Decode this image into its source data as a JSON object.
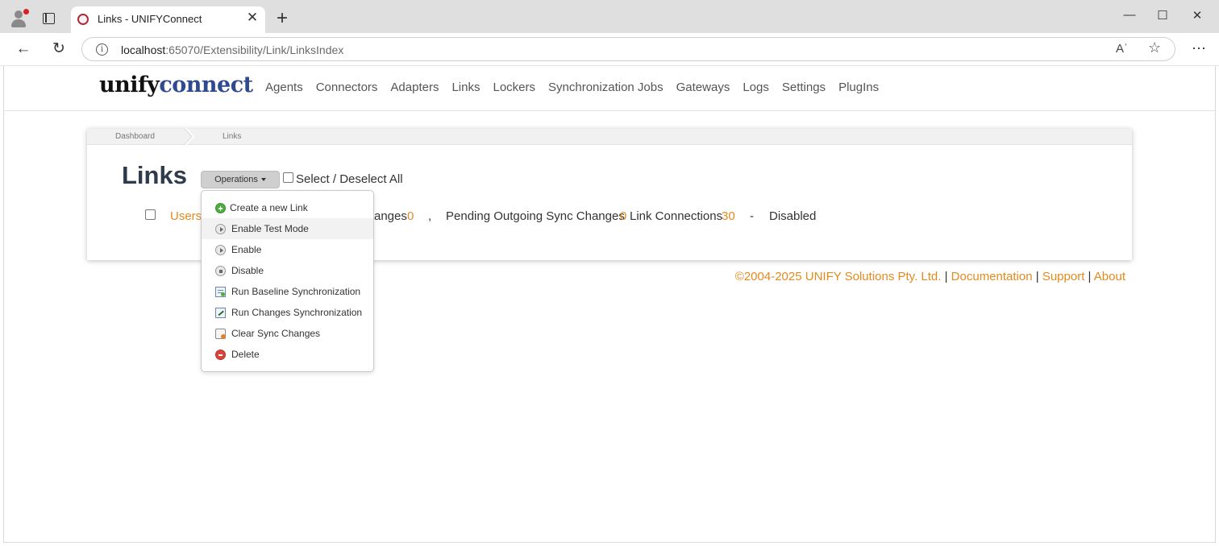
{
  "browser": {
    "tab_title": "Links - UNIFYConnect",
    "tab_close": "✕",
    "new_tab": "+",
    "url_host": "localhost",
    "url_path": ":65070/Extensibility/Link/LinksIndex",
    "info_glyph": "i",
    "read_aloud_glyph": "Aʾ",
    "favorite_glyph": "☆",
    "more_glyph": "⋯",
    "back_glyph": "←",
    "refresh_glyph": "↻",
    "minimize_glyph": "—",
    "maximize_glyph": "☐",
    "close_glyph": "✕"
  },
  "header": {
    "logo_unify": "unify",
    "logo_connect": "connect",
    "nav": [
      "Agents",
      "Connectors",
      "Adapters",
      "Links",
      "Lockers",
      "Synchronization Jobs",
      "Gateways",
      "Logs",
      "Settings",
      "PlugIns"
    ]
  },
  "breadcrumb": {
    "items": [
      "Dashboard",
      "Links"
    ]
  },
  "main": {
    "title": "Links",
    "operations_label": "Operations",
    "select_all_label": "Select / Deselect All"
  },
  "link_row": {
    "name": "Users",
    "incoming_label": "anges",
    "incoming_value": "0",
    "comma": ",",
    "outgoing_label": "Pending Outgoing Sync Changes",
    "outgoing_value": "0",
    "connections_label": "Link Connections",
    "connections_value": "30",
    "dash": "-",
    "status": "Disabled"
  },
  "dropdown": {
    "items": [
      {
        "label": "Create a new Link",
        "icon": "add-icon"
      },
      {
        "label": "Enable Test Mode",
        "icon": "play-icon"
      },
      {
        "label": "Enable",
        "icon": "play-icon"
      },
      {
        "label": "Disable",
        "icon": "stop-icon"
      },
      {
        "label": "Run Baseline Synchronization",
        "icon": "baseline-sync-icon"
      },
      {
        "label": "Run Changes Synchronization",
        "icon": "changes-sync-icon"
      },
      {
        "label": "Clear Sync Changes",
        "icon": "clear-changes-icon"
      },
      {
        "label": "Delete",
        "icon": "delete-icon"
      }
    ]
  },
  "footer": {
    "copyright": "©2004-2025 UNIFY Solutions Pty. Ltd.",
    "sep": "|",
    "documentation": "Documentation",
    "support": "Support",
    "about": "About"
  },
  "colors": {
    "accent_orange": "#e38a1d",
    "logo_blue": "#2f4a8f",
    "title_text": "#2f3b4c"
  }
}
